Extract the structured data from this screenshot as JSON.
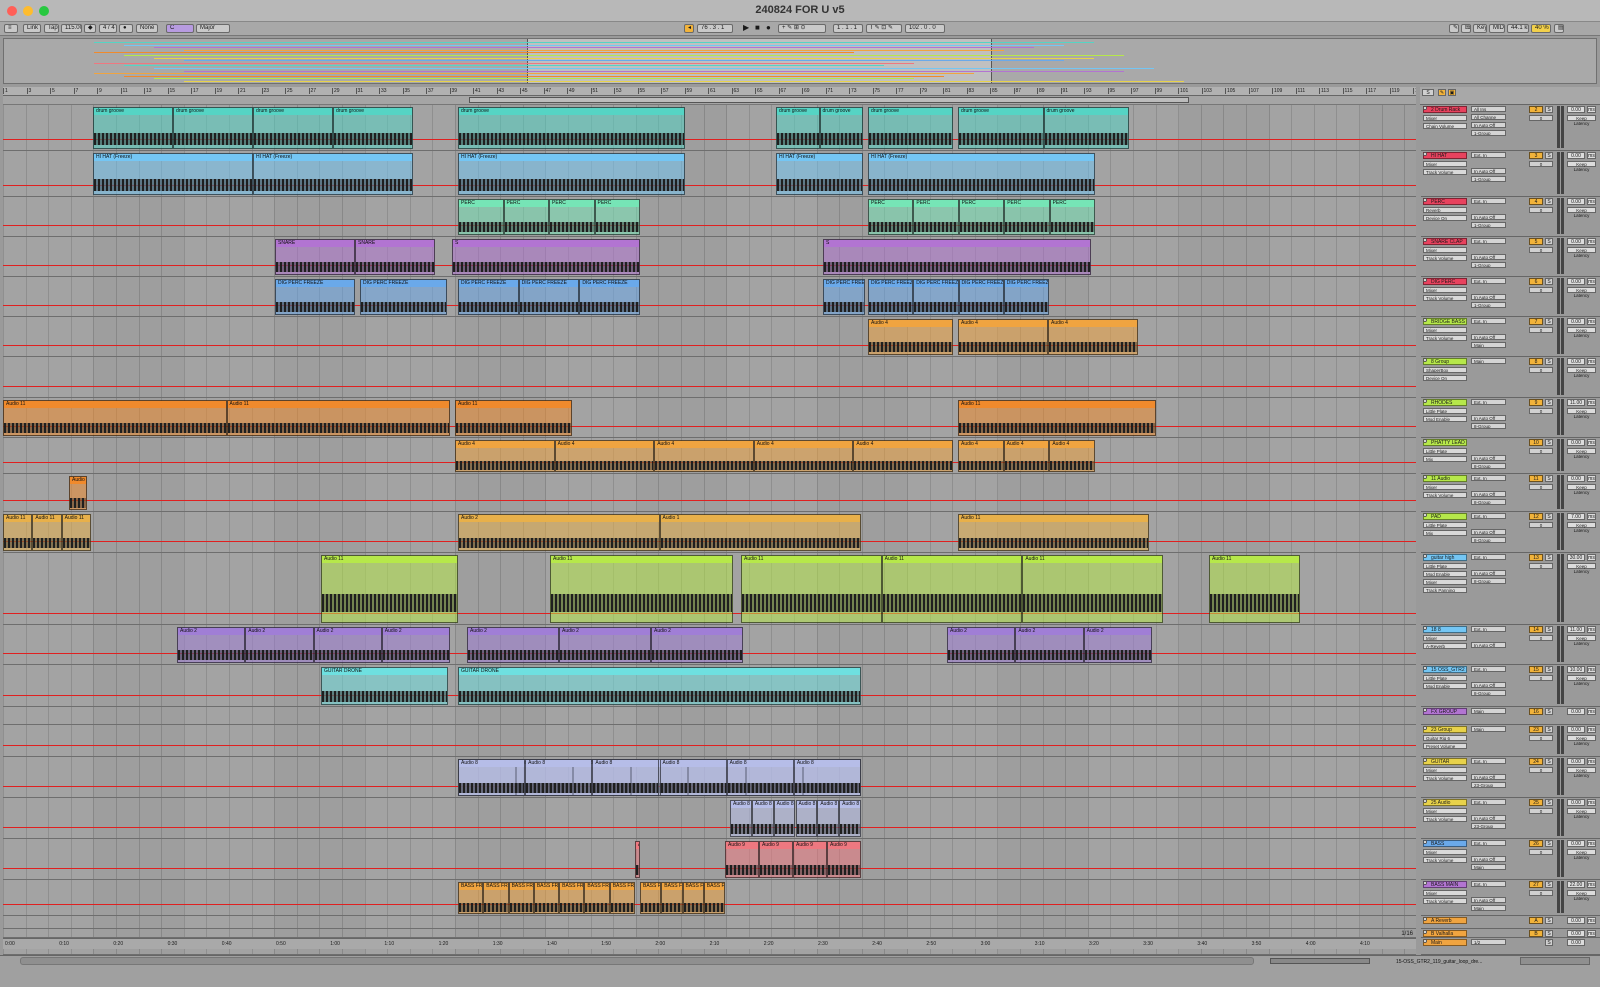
{
  "window": {
    "title": "240824 FOR U v5"
  },
  "colors": {
    "red": "#ff5f57",
    "yellow": "#febc2e",
    "green": "#28c840"
  },
  "control_bar": {
    "items": [
      "Link",
      "Tap",
      "115.00",
      "4 / 4",
      "None",
      "C",
      "Major",
      "76 . 3 . 1",
      "1 . 1 . 1",
      "102 . 0 . 0",
      "Key",
      "MIDI",
      "44.1 kHz",
      "40 %"
    ]
  },
  "ruler": {
    "bars": [
      "1",
      "3",
      "5",
      "7",
      "9",
      "11",
      "13",
      "15",
      "17",
      "19",
      "21",
      "23",
      "25",
      "27",
      "29",
      "31",
      "33",
      "35",
      "37",
      "39",
      "41",
      "43",
      "45",
      "47",
      "49",
      "51",
      "53",
      "55",
      "57",
      "59",
      "61",
      "63",
      "65",
      "67",
      "69",
      "71",
      "73",
      "75",
      "77",
      "79",
      "81",
      "83",
      "85",
      "87",
      "89",
      "91",
      "93",
      "95",
      "97",
      "99",
      "101",
      "103",
      "105",
      "107",
      "109",
      "111",
      "113",
      "115",
      "117",
      "119",
      "121"
    ]
  },
  "time_ruler": {
    "marks": [
      "0:00",
      "0:10",
      "0:20",
      "0:30",
      "0:40",
      "0:50",
      "1:00",
      "1:10",
      "1:20",
      "1:30",
      "1:40",
      "1:50",
      "2:00",
      "2:10",
      "2:20",
      "2:30",
      "2:40",
      "2:50",
      "3:00",
      "3:10",
      "3:20",
      "3:30",
      "3:40",
      "3:50",
      "4:00",
      "4:10"
    ],
    "zoom": "1/16"
  },
  "clip_color_hex": [
    "#55d4c4",
    "#74c6f4",
    "#76e5b6",
    "#b274d2",
    "#6aa9ea",
    "#f0a440",
    "#f08a2c",
    "#e8b04a",
    "#b6e84a",
    "#a07ed6",
    "#6ee0e0",
    "#b6bde8",
    "#ee7880",
    "#f0a440"
  ],
  "tracks": [
    {
      "name": "2 Drum Rack",
      "color": "#e8425e",
      "num": "2",
      "devices": [
        "Mixer",
        "Chain Volume"
      ],
      "io": [
        "All Ins",
        "All Channe",
        "In Auto Off",
        "1-Group"
      ],
      "delay": "0.00",
      "unit": "ms",
      "latency": "Keep Latency",
      "clips": [
        [
          "drum groove",
          "drum groove",
          "drum groove",
          "drum groove"
        ],
        [
          "drum groove"
        ],
        [
          "drum groove",
          "drum groove"
        ],
        [
          "drum groove"
        ],
        [
          "drum groove",
          "drum groove"
        ]
      ]
    },
    {
      "name": "HI HAT",
      "color": "#e8425e",
      "num": "3",
      "devices": [
        "Mixer",
        "Track Volume"
      ],
      "io": [
        "Ext. In",
        "",
        "In Auto Off",
        "1-Group"
      ],
      "delay": "0.00",
      "unit": "ms",
      "latency": "Keep Latency",
      "clips": [
        [
          "HI HAT (Freeze)",
          "HI HAT (Freeze)"
        ],
        [
          "HI HAT (Freeze)"
        ],
        [
          "HI HAT (Freeze)"
        ],
        [
          "HI HAT (Freeze)"
        ]
      ]
    },
    {
      "name": "PERC",
      "color": "#e8425e",
      "num": "4",
      "devices": [
        "Reverb",
        "Device On"
      ],
      "io": [
        "Ext. In",
        "",
        "In Auto Off",
        "1-Group"
      ],
      "delay": "0.00",
      "unit": "ms",
      "latency": "Keep Latency",
      "clips": [
        [
          "PERC",
          "PERC",
          "PERC",
          "PERC"
        ],
        [
          "PERC",
          "PERC",
          "PERC",
          "PERC",
          "PERC"
        ]
      ]
    },
    {
      "name": "SNARE CLAP",
      "color": "#e8425e",
      "num": "5",
      "devices": [
        "Mixer",
        "Track Volume"
      ],
      "io": [
        "Ext. In",
        "",
        "In Auto Off",
        "1-Group"
      ],
      "delay": "0.00",
      "unit": "ms",
      "latency": "Keep Latency",
      "clips": [
        [
          "SNARE",
          "SNARE"
        ],
        [
          "S"
        ],
        [
          "S"
        ]
      ]
    },
    {
      "name": "DIG PERC",
      "color": "#e8425e",
      "num": "6",
      "devices": [
        "Mixer",
        "Track Volume"
      ],
      "io": [
        "Ext. In",
        "",
        "In Auto Off",
        "1-Group"
      ],
      "delay": "0.00",
      "unit": "ms",
      "latency": "Keep Latency",
      "clips": [
        [
          "DIG PERC FREEZE"
        ],
        [
          "DIG PERC FREEZE"
        ],
        [
          "DIG PERC FREEZE",
          "DIG PERC FREEZE",
          "DIG PERC FREEZE"
        ],
        [
          "DIG PERC FREEZE"
        ],
        [
          "DIG PERC FREEZE",
          "DIG PERC FREEZE",
          "DIG PERC FREEZE",
          "DIG PERC FREEZE"
        ]
      ]
    },
    {
      "name": "BRIDGE BASS",
      "color": "#b6e84a",
      "num": "7",
      "devices": [
        "Mixer",
        "Track Volume"
      ],
      "io": [
        "Ext. In",
        "",
        "In Auto Off",
        "Main"
      ],
      "delay": "0.00",
      "unit": "ms",
      "latency": "Keep Latency",
      "clips": [
        [
          "Audio 4"
        ],
        [
          "Audio 4",
          "Audio 4"
        ]
      ]
    },
    {
      "name": "8 Group",
      "color": "#b6e84a",
      "num": "8",
      "devices": [
        "ShaperBox",
        "Device On"
      ],
      "io": [
        "Main",
        "",
        "",
        ""
      ],
      "delay": "0.00",
      "unit": "ms",
      "latency": "Keep Latency",
      "clips": []
    },
    {
      "name": "RHODES",
      "color": "#b6e84a",
      "num": "9",
      "devices": [
        "Little Plate",
        "Mod Enable"
      ],
      "io": [
        "Ext. In",
        "",
        "In Auto Off",
        "8-Group"
      ],
      "delay": "11.00",
      "unit": "ms",
      "latency": "Keep Latency",
      "clips": [
        [
          "Audio 11",
          "Audio 11"
        ],
        [
          "Audio 11"
        ],
        [
          "Audio 11"
        ]
      ]
    },
    {
      "name": "PHATTY LEAD",
      "color": "#b6e84a",
      "num": "10",
      "devices": [
        "Little Plate",
        "Mix"
      ],
      "io": [
        "",
        "",
        "In Auto Off",
        "8-Group"
      ],
      "delay": "0.00",
      "unit": "ms",
      "latency": "Keep Latency",
      "clips": [
        [
          "Audio 4",
          "Audio 4",
          "Audio 4",
          "Audio 4",
          "Audio 4"
        ],
        [
          "Audio 4",
          "Audio 4",
          "Audio 4"
        ]
      ]
    },
    {
      "name": "11 Audio",
      "color": "#b6e84a",
      "num": "11",
      "devices": [
        "Mixer",
        "Track Volume"
      ],
      "io": [
        "Ext. In",
        "",
        "In Auto Off",
        "8-Group"
      ],
      "delay": "0.00",
      "unit": "ms",
      "latency": "Keep Latency",
      "clips": [
        [
          "Audio"
        ]
      ]
    },
    {
      "name": "PAD",
      "color": "#b6e84a",
      "num": "12",
      "devices": [
        "Little Plate",
        "Mix"
      ],
      "io": [
        "Ext. In",
        "",
        "In Auto Off",
        "8-Group"
      ],
      "delay": "7.00",
      "unit": "ms",
      "latency": "Keep Latency",
      "clips": [
        [
          "Audio 11",
          "Audio 11",
          "Audio 11"
        ],
        [
          "Audio 2",
          "Audio 1"
        ],
        [
          "Audio 11"
        ]
      ]
    },
    {
      "name": "guitar high",
      "color": "#74c6f4",
      "num": "13",
      "devices": [
        "Little Plate",
        "Mod Enable",
        "Mixer",
        "Track Panning"
      ],
      "io": [
        "Ext. In",
        "",
        "In Auto Off",
        "8-Group"
      ],
      "delay": "30.00",
      "unit": "ms",
      "latency": "Keep Latency",
      "clips": [
        [
          "Audio 11"
        ],
        [
          "Audio 11"
        ],
        [
          "Audio 11",
          "Audio 11",
          "Audio 11"
        ],
        [
          "Audio 11"
        ]
      ]
    },
    {
      "name": "18 8",
      "color": "#74c6f4",
      "num": "14",
      "devices": [
        "Mixer",
        "A-Reverb"
      ],
      "io": [
        "Ext. In",
        "",
        "In Auto Off",
        ""
      ],
      "delay": "11.00",
      "unit": "ms",
      "latency": "Keep Latency",
      "clips": [
        [
          "Audio 2",
          "Audio 2",
          "Audio 2",
          "Audio 2"
        ],
        [
          "Audio 2",
          "Audio 2",
          "Audio 2"
        ],
        [
          "Audio 2",
          "Audio 2",
          "Audio 2"
        ]
      ]
    },
    {
      "name": "15 OSS_GTR2",
      "color": "#74c6f4",
      "num": "15",
      "devices": [
        "Little Plate",
        "Mod Enable"
      ],
      "io": [
        "Ext. In",
        "",
        "In Auto Off",
        "8-Group"
      ],
      "delay": "10.00",
      "unit": "ms",
      "latency": "Keep Latency",
      "clips": [
        [
          "GUITAR DRONE"
        ],
        [
          "GUITAR DRONE"
        ]
      ]
    },
    {
      "name": "FX GROUP",
      "color": "#b274d2",
      "num": "16",
      "devices": [],
      "io": [
        "Main",
        "",
        "",
        ""
      ],
      "delay": "0.00",
      "unit": "ms",
      "latency": "Keep Latency",
      "clips": []
    },
    {
      "name": "23 Group",
      "color": "#e8d24a",
      "num": "23",
      "devices": [
        "Guitar Rig 6",
        "Preset Volume"
      ],
      "io": [
        "Main",
        "",
        "",
        ""
      ],
      "delay": "0.00",
      "unit": "ms",
      "latency": "Keep Latency",
      "clips": []
    },
    {
      "name": "GUITAR",
      "color": "#e8d24a",
      "num": "24",
      "devices": [
        "Mixer",
        "Track Volume"
      ],
      "io": [
        "Ext. In",
        "",
        "In Auto Off",
        "23-Group"
      ],
      "delay": "0.00",
      "unit": "ms",
      "latency": "Keep Latency",
      "clips": [
        [
          "Audio 8",
          "Audio 8",
          "Audio 8",
          "Audio 8",
          "Audio 8",
          "Audio 8",
          "Audio 8"
        ],
        [
          "Audio 8",
          "Audio 8",
          "Audio 8",
          "Audio 8",
          "Audio 8",
          "Audio 8"
        ]
      ]
    },
    {
      "name": "25 Audio",
      "color": "#e8d24a",
      "num": "25",
      "devices": [
        "Mixer",
        "Track Volume"
      ],
      "io": [
        "Ext. In",
        "",
        "In Auto Off",
        "23-Group"
      ],
      "delay": "0.00",
      "unit": "ms",
      "latency": "Keep Latency",
      "clips": [
        [
          "Audio 8",
          "Audio 8",
          "Audio 8",
          "Audio 8",
          "Audio 8",
          "Audio 8"
        ]
      ]
    },
    {
      "name": "BASS",
      "color": "#6aa9ea",
      "num": "26",
      "devices": [
        "Mixer",
        "Track Volume"
      ],
      "io": [
        "Ext. In",
        "",
        "In Auto Off",
        "Main"
      ],
      "delay": "0.00",
      "unit": "ms",
      "latency": "Keep Latency",
      "clips": [
        [
          "A"
        ],
        [
          "Audio 9",
          "Audio 9",
          "Audio 9",
          "Audio 9"
        ]
      ]
    },
    {
      "name": "BASS MAIN",
      "color": "#b274d2",
      "num": "27",
      "devices": [
        "Mixer",
        "Track Volume"
      ],
      "io": [
        "Ext. In",
        "",
        "In Auto Off",
        "Main"
      ],
      "delay": "22.00",
      "unit": "ms",
      "latency": "Keep Latency",
      "clips": [
        [
          "BASS FRE",
          "BASS FRE",
          "BASS FRE",
          "BASS FRE",
          "BASS FRE",
          "BASS FRE",
          "BASS FRE"
        ],
        [
          "BASS FRE",
          "BASS FRE",
          "BASS FRE",
          "BASS FRE"
        ]
      ]
    },
    {
      "name": "A Reverb",
      "color": "#f0a440",
      "num": "A",
      "devices": [],
      "io": [
        "",
        "",
        "",
        ""
      ],
      "delay": "0.00",
      "unit": "ms",
      "latency": "Keep Latency",
      "clips": []
    },
    {
      "name": "B Valhalla",
      "color": "#f0a440",
      "num": "B",
      "devices": [],
      "io": [
        "",
        "",
        "",
        ""
      ],
      "delay": "0.00",
      "unit": "ms",
      "latency": "Keep Latency",
      "clips": []
    },
    {
      "name": "Main",
      "color": "#f0a440",
      "num": "",
      "devices": [],
      "io": [
        "1/2",
        "",
        "",
        ""
      ],
      "delay": "0.00",
      "unit": "",
      "latency": "",
      "clips": []
    }
  ],
  "status": {
    "file": "15-OSS_GTR2_119_guitar_loop_dre..."
  }
}
